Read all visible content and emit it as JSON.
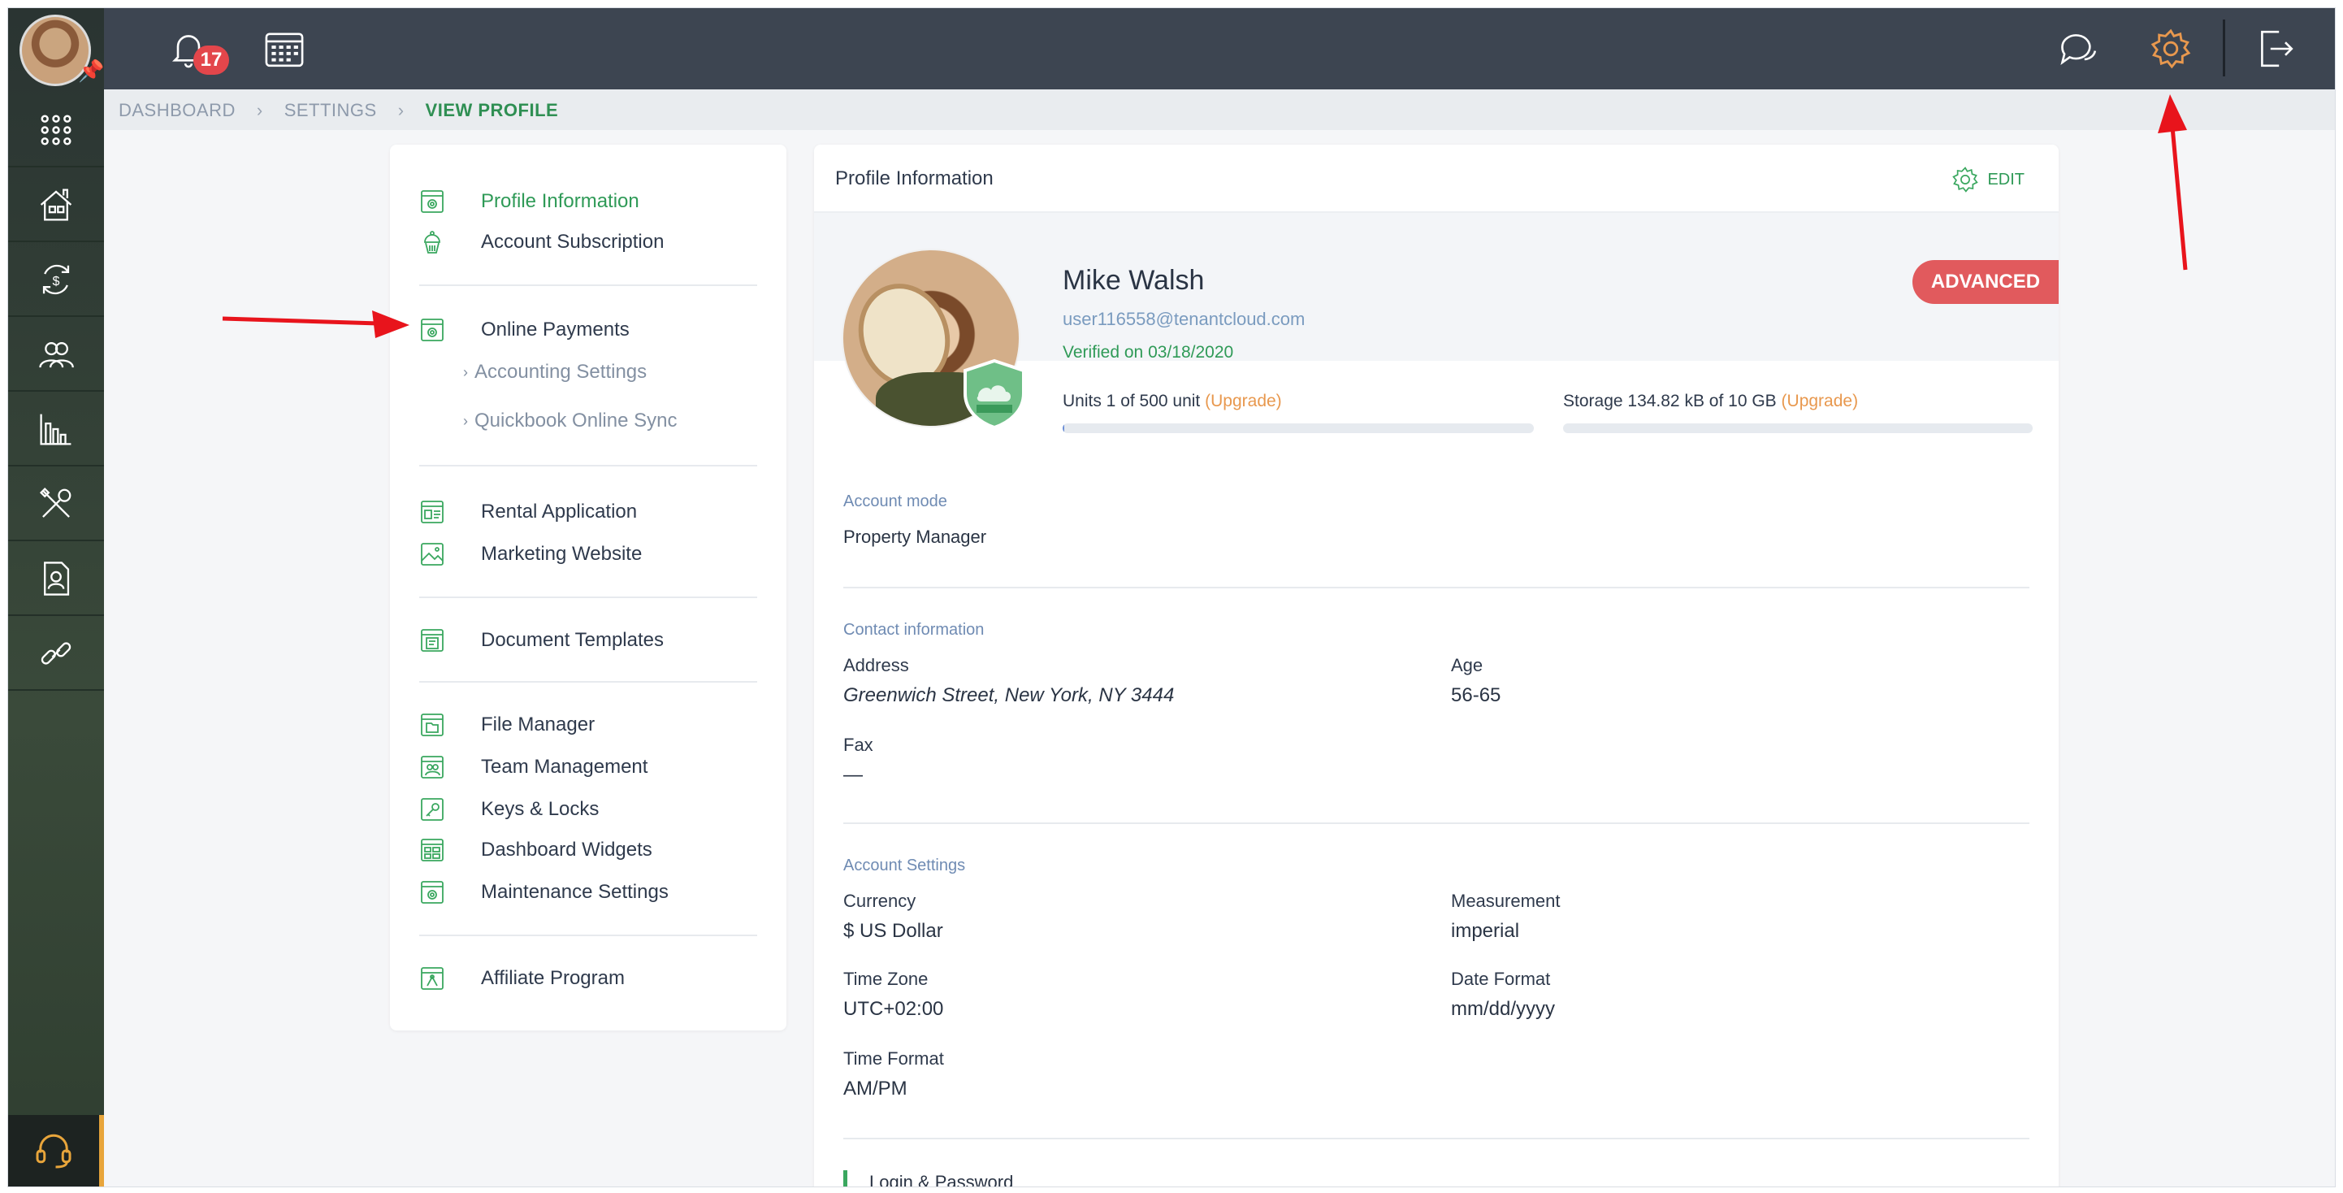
{
  "header": {
    "notifications_count": "17"
  },
  "breadcrumb": {
    "items": [
      "DASHBOARD",
      "SETTINGS",
      "VIEW PROFILE"
    ]
  },
  "menu": {
    "items": [
      {
        "label": "Profile Information",
        "icon": "profile-icon",
        "active": true
      },
      {
        "label": "Account Subscription",
        "icon": "cupcake-icon"
      },
      {
        "label": "Online Payments",
        "icon": "payments-icon"
      },
      {
        "label": "Accounting Settings",
        "sub": true
      },
      {
        "label": "Quickbook Online Sync",
        "sub": true
      },
      {
        "label": "Rental Application",
        "icon": "application-icon"
      },
      {
        "label": "Marketing Website",
        "icon": "website-icon"
      },
      {
        "label": "Document Templates",
        "icon": "document-icon"
      },
      {
        "label": "File Manager",
        "icon": "file-icon"
      },
      {
        "label": "Team Management",
        "icon": "team-icon"
      },
      {
        "label": "Keys & Locks",
        "icon": "key-icon"
      },
      {
        "label": "Dashboard Widgets",
        "icon": "widgets-icon"
      },
      {
        "label": "Maintenance Settings",
        "icon": "maintenance-icon"
      },
      {
        "label": "Affiliate Program",
        "icon": "affiliate-icon"
      }
    ]
  },
  "profile": {
    "title": "Profile Information",
    "edit_label": "EDIT",
    "name": "Mike Walsh",
    "email": "user116558@tenantcloud.com",
    "verified": "Verified on 03/18/2020",
    "plan": "ADVANCED",
    "units_text": "Units 1 of 500 unit",
    "storage_text": "Storage 134.82 kB of 10 GB",
    "upgrade_label": "(Upgrade)",
    "units_fraction": 0.002,
    "storage_fraction": 0.0,
    "account_mode_label": "Account mode",
    "account_mode_value": "Property Manager",
    "contact_label": "Contact information",
    "address_label": "Address",
    "address_value": "Greenwich Street, New York, NY 3444",
    "age_label": "Age",
    "age_value": "56-65",
    "fax_label": "Fax",
    "fax_value": "—",
    "account_settings_label": "Account Settings",
    "currency_label": "Currency",
    "currency_value": "$ US Dollar",
    "measurement_label": "Measurement",
    "measurement_value": "imperial",
    "timezone_label": "Time Zone",
    "timezone_value": "UTC+02:00",
    "dateformat_label": "Date Format",
    "dateformat_value": "mm/dd/yyyy",
    "timeformat_label": "Time Format",
    "timeformat_value": "AM/PM",
    "login_label": "Login & Password"
  },
  "colors": {
    "accent_green": "#2f9a57",
    "badge_red": "#e3464b",
    "plan_red": "#e15a5d",
    "upgrade_orange": "#e8984e",
    "header_dark": "#3d4551",
    "annotation_red": "#e8141c"
  }
}
